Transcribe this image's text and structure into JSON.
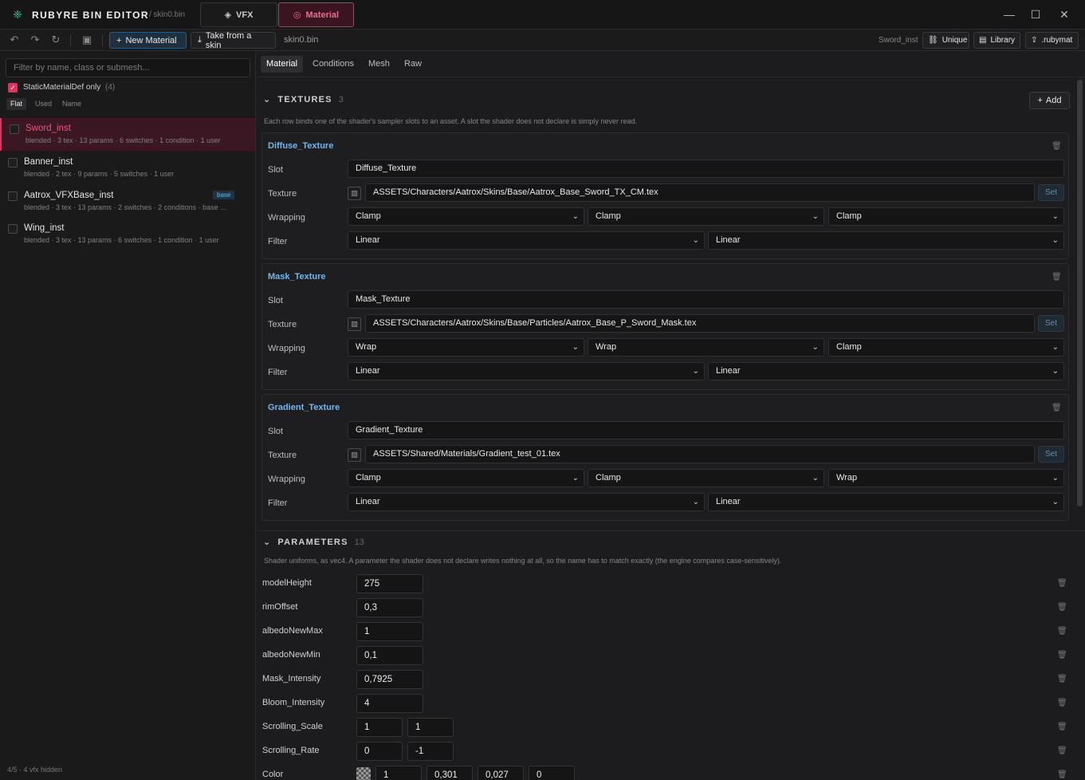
{
  "app": {
    "name": "RUBYRE BIN EDITOR",
    "file": "/ skin0.bin",
    "tabs": {
      "vfx": "VFX",
      "material": "Material"
    }
  },
  "toolbar": {
    "new_material": "New Material",
    "take_skin": "Take from a skin",
    "file": "skin0.bin",
    "current": "Sword_inst",
    "unique": "Unique",
    "library": "Library",
    "rubymat": ".rubymat"
  },
  "sidebar": {
    "filter_placeholder": "Filter by name, class or submesh...",
    "static_label": "StaticMaterialDef only",
    "static_count": "(4)",
    "modes": {
      "flat": "Flat",
      "used": "Used",
      "name": "Name"
    },
    "items": [
      {
        "name": "Sword_inst",
        "meta": "blended · 3 tex · 13 params · 6 switches · 1 condition · 1 user"
      },
      {
        "name": "Banner_inst",
        "meta": "blended · 2 tex · 9 params · 5 switches · 1 user"
      },
      {
        "name": "Aatrox_VFXBase_inst",
        "meta": "blended · 3 tex · 13 params · 2 switches · 2 conditions · base ...",
        "badge": "base"
      },
      {
        "name": "Wing_inst",
        "meta": "blended · 3 tex · 13 params · 6 switches · 1 condition · 1 user"
      }
    ],
    "footer": "4/5 · 4 vfx hidden"
  },
  "subtabs": {
    "material": "Material",
    "conditions": "Conditions",
    "mesh": "Mesh",
    "raw": "Raw"
  },
  "textures": {
    "title": "TEXTURES",
    "count": "3",
    "add": "Add",
    "desc": "Each row binds one of the shader's sampler slots to an asset. A slot the shader does not declare is simply never read.",
    "labels": {
      "slot": "Slot",
      "texture": "Texture",
      "wrapping": "Wrapping",
      "filter": "Filter",
      "set": "Set"
    },
    "items": [
      {
        "title": "Diffuse_Texture",
        "slot": "Diffuse_Texture",
        "path": "ASSETS/Characters/Aatrox/Skins/Base/Aatrox_Base_Sword_TX_CM.tex",
        "wrap": [
          "Clamp",
          "Clamp",
          "Clamp"
        ],
        "filter": [
          "Linear",
          "Linear"
        ]
      },
      {
        "title": "Mask_Texture",
        "slot": "Mask_Texture",
        "path": "ASSETS/Characters/Aatrox/Skins/Base/Particles/Aatrox_Base_P_Sword_Mask.tex",
        "wrap": [
          "Wrap",
          "Wrap",
          "Clamp"
        ],
        "filter": [
          "Linear",
          "Linear"
        ]
      },
      {
        "title": "Gradient_Texture",
        "slot": "Gradient_Texture",
        "path": "ASSETS/Shared/Materials/Gradient_test_01.tex",
        "wrap": [
          "Clamp",
          "Clamp",
          "Wrap"
        ],
        "filter": [
          "Linear",
          "Linear"
        ]
      }
    ]
  },
  "parameters": {
    "title": "PARAMETERS",
    "count": "13",
    "desc": "Shader uniforms, as vec4. A parameter the shader does not declare writes nothing at all, so the name has to match exactly (the engine compares case-sensitively).",
    "items": [
      {
        "name": "modelHeight",
        "values": [
          "275"
        ]
      },
      {
        "name": "rimOffset",
        "values": [
          "0,3"
        ]
      },
      {
        "name": "albedoNewMax",
        "values": [
          "1"
        ]
      },
      {
        "name": "albedoNewMin",
        "values": [
          "0,1"
        ]
      },
      {
        "name": "Mask_Intensity",
        "values": [
          "0,7925"
        ]
      },
      {
        "name": "Bloom_Intensity",
        "values": [
          "4"
        ]
      },
      {
        "name": "Scrolling_Scale",
        "values": [
          "1",
          "1"
        ]
      },
      {
        "name": "Scrolling_Rate",
        "values": [
          "0",
          "-1"
        ]
      },
      {
        "name": "Color",
        "values": [
          "1",
          "0,301",
          "0,027",
          "0"
        ]
      }
    ]
  },
  "colors": {
    "accent": "#d9365f",
    "link": "#6db8f0",
    "bg": "#1c1c1e"
  }
}
